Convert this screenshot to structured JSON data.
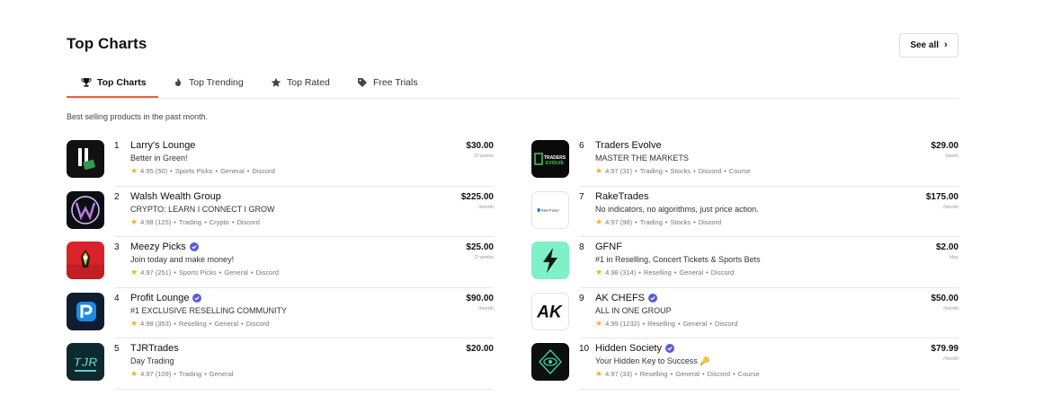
{
  "header": {
    "title": "Top Charts",
    "see_all_label": "See all"
  },
  "tabs": [
    {
      "label": "Top Charts",
      "icon": "trophy-icon"
    },
    {
      "label": "Top Trending",
      "icon": "flame-icon"
    },
    {
      "label": "Top Rated",
      "icon": "star-icon"
    },
    {
      "label": "Free Trials",
      "icon": "tag-icon"
    }
  ],
  "subtitle": "Best selling products in the past month.",
  "colors": {
    "accent": "#e8613c",
    "star": "#f5b027",
    "verified": "#5b5bd6"
  },
  "products": [
    {
      "rank": "1",
      "name": "Larry's Lounge",
      "verified": false,
      "desc": "Better in Green!",
      "rating": "4.95 (50)",
      "tags": [
        "Sports Picks",
        "General",
        "Discord"
      ],
      "price": "$30.00",
      "period": "/2 weeks"
    },
    {
      "rank": "2",
      "name": "Walsh Wealth Group",
      "verified": false,
      "desc": "CRYPTO: LEARN I CONNECT I GROW",
      "rating": "4.98 (125)",
      "tags": [
        "Trading",
        "Crypto",
        "Discord"
      ],
      "price": "$225.00",
      "period": "/month"
    },
    {
      "rank": "3",
      "name": "Meezy Picks",
      "verified": true,
      "desc": "Join today and make money!",
      "rating": "4.97 (251)",
      "tags": [
        "Sports Picks",
        "General",
        "Discord"
      ],
      "price": "$25.00",
      "period": "/2 weeks"
    },
    {
      "rank": "4",
      "name": "Profit Lounge",
      "verified": true,
      "desc": "#1 EXCLUSIVE RESELLING COMMUNITY",
      "rating": "4.98 (353)",
      "tags": [
        "Reselling",
        "General",
        "Discord"
      ],
      "price": "$90.00",
      "period": "/month"
    },
    {
      "rank": "5",
      "name": "TJRTrades",
      "verified": false,
      "desc": "Day Trading",
      "rating": "4.97 (109)",
      "tags": [
        "Trading",
        "General"
      ],
      "price": "$20.00",
      "period": ""
    },
    {
      "rank": "6",
      "name": "Traders Evolve",
      "verified": false,
      "desc": "MASTER THE MARKETS",
      "rating": "4.97 (31)",
      "tags": [
        "Trading",
        "Stocks",
        "Discord",
        "Course"
      ],
      "price": "$29.00",
      "period": "/week"
    },
    {
      "rank": "7",
      "name": "RakeTrades",
      "verified": false,
      "desc": "No indicators, no algorithms, just price action.",
      "rating": "4.97 (98)",
      "tags": [
        "Trading",
        "Stocks",
        "Discord"
      ],
      "price": "$175.00",
      "period": "/month"
    },
    {
      "rank": "8",
      "name": "GFNF",
      "verified": false,
      "desc": "#1 in Reselling, Concert Tickets & Sports Bets",
      "rating": "4.98 (314)",
      "tags": [
        "Reselling",
        "General",
        "Discord"
      ],
      "price": "$2.00",
      "period": "/day"
    },
    {
      "rank": "9",
      "name": "AK CHEFS",
      "verified": true,
      "desc": "ALL IN ONE GROUP",
      "rating": "4.99 (1232)",
      "tags": [
        "Reselling",
        "General",
        "Discord"
      ],
      "price": "$50.00",
      "period": "/month"
    },
    {
      "rank": "10",
      "name": "Hidden Society",
      "verified": true,
      "desc": "Your Hidden Key to Success 🔑",
      "rating": "4.97 (33)",
      "tags": [
        "Reselling",
        "General",
        "Discord",
        "Course"
      ],
      "price": "$79.99",
      "period": "/month"
    }
  ],
  "logos": {
    "larrys": {
      "text": ""
    },
    "rake": {
      "text": "RakeTrades"
    },
    "traders": {
      "text": "TRADERS EVOLVE"
    },
    "tjr": {
      "text": "TJR"
    },
    "ak": {
      "text": "AK"
    }
  }
}
